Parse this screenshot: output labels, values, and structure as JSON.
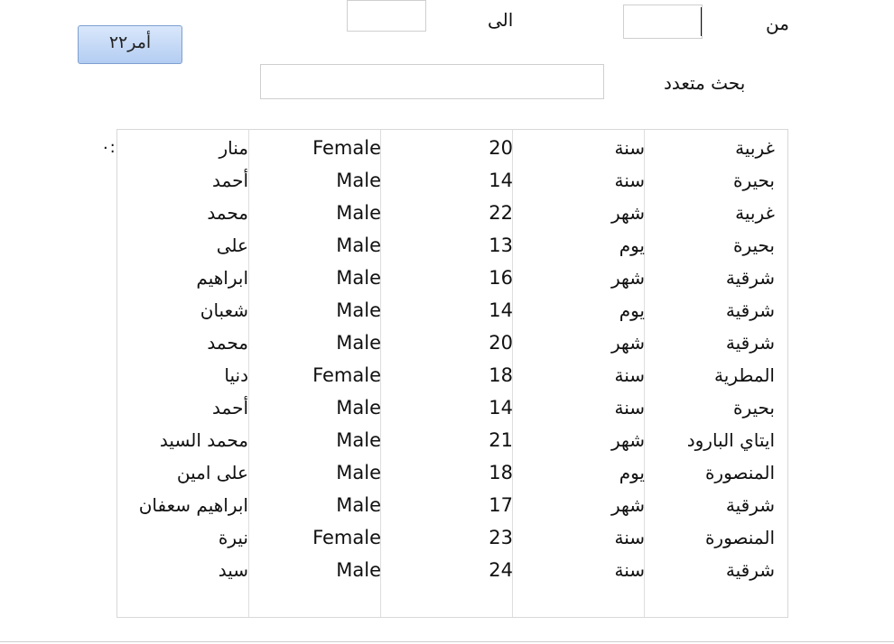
{
  "filters": {
    "from_label": "من",
    "to_label": "الى",
    "from_value": "",
    "to_value": "",
    "multi_search_label": "بحث متعدد",
    "multi_search_value": ""
  },
  "command_button": {
    "label": "أمر٢٢"
  },
  "record_counter": ":٠",
  "rows": [
    {
      "governorate": "غربية",
      "unit": "سنة",
      "age": "20",
      "gender": "Female",
      "name": "منار"
    },
    {
      "governorate": "بحيرة",
      "unit": "سنة",
      "age": "14",
      "gender": "Male",
      "name": "أحمد"
    },
    {
      "governorate": "غربية",
      "unit": "شهر",
      "age": "22",
      "gender": "Male",
      "name": "محمد"
    },
    {
      "governorate": "بحيرة",
      "unit": "يوم",
      "age": "13",
      "gender": "Male",
      "name": "على"
    },
    {
      "governorate": "شرقية",
      "unit": "شهر",
      "age": "16",
      "gender": "Male",
      "name": "ابراهيم"
    },
    {
      "governorate": "شرقية",
      "unit": "يوم",
      "age": "14",
      "gender": "Male",
      "name": "شعبان"
    },
    {
      "governorate": "شرقية",
      "unit": "شهر",
      "age": "20",
      "gender": "Male",
      "name": "محمد"
    },
    {
      "governorate": "المطرية",
      "unit": "سنة",
      "age": "18",
      "gender": "Female",
      "name": "دنيا"
    },
    {
      "governorate": "بحيرة",
      "unit": "سنة",
      "age": "14",
      "gender": "Male",
      "name": "أحمد"
    },
    {
      "governorate": "ايتاي البارود",
      "unit": "شهر",
      "age": "21",
      "gender": "Male",
      "name": "محمد السيد"
    },
    {
      "governorate": "المنصورة",
      "unit": "يوم",
      "age": "18",
      "gender": "Male",
      "name": "على امين"
    },
    {
      "governorate": "شرقية",
      "unit": "شهر",
      "age": "17",
      "gender": "Male",
      "name": "ابراهيم سعفان"
    },
    {
      "governorate": "المنصورة",
      "unit": "سنة",
      "age": "23",
      "gender": "Female",
      "name": "نيرة"
    },
    {
      "governorate": "شرقية",
      "unit": "سنة",
      "age": "24",
      "gender": "Male",
      "name": "سيد"
    }
  ]
}
